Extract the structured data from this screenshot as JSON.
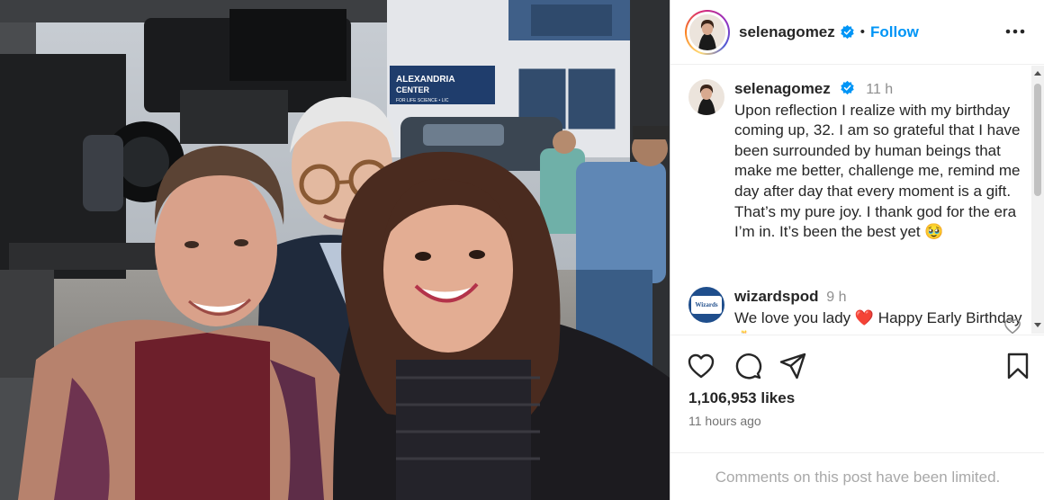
{
  "post": {
    "username": "selenagomez",
    "separator": "•",
    "follow_label": "Follow"
  },
  "caption": {
    "username": "selenagomez",
    "time": "11 h",
    "text": "Upon reflection I realize with my birthday coming up, 32. I am so grateful that I have been surrounded by human beings that make me better, challenge me, remind me day after day that every moment is a gift. That’s my pure joy. I thank god for the era I’m in. It’s been the best yet 🥹"
  },
  "comments": [
    {
      "username": "wizardspod",
      "time": "9 h",
      "text_before": "We love you lady",
      "emoji": "❤️",
      "text_after": "Happy Early Birthday 🎂",
      "avatar_text": "Wizards"
    }
  ],
  "photo": {
    "sign_line1": "ALEXANDRIA",
    "sign_line2": "CENTER",
    "sign_line3": "FOR LIFE SCIENCE • LIC"
  },
  "engagement": {
    "likes": "1,106,953 likes",
    "time_ago": "11 hours ago",
    "limited_notice": "Comments on this post have been limited."
  },
  "icons": [
    "heart-icon",
    "comment-icon",
    "share-icon",
    "bookmark-icon",
    "more-options-icon",
    "verified-badge-icon"
  ],
  "colors": {
    "follow_blue": "#0095f6",
    "verified_blue": "#0095f6",
    "muted": "#8e8e8e"
  }
}
